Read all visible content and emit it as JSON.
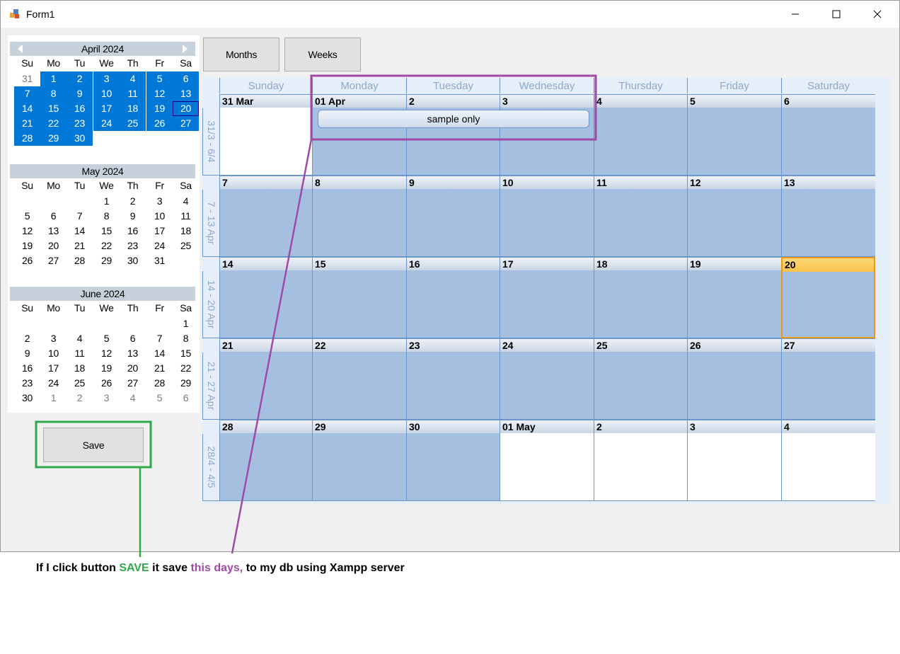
{
  "window": {
    "title": "Form1"
  },
  "accent": "#0078d7",
  "month_calendar": {
    "dow": [
      "Su",
      "Mo",
      "Tu",
      "We",
      "Th",
      "Fr",
      "Sa"
    ],
    "months": [
      {
        "title": "April 2024",
        "weeks": [
          [
            "31",
            "1",
            "2",
            "3",
            "4",
            "5",
            "6"
          ],
          [
            "7",
            "8",
            "9",
            "10",
            "11",
            "12",
            "13"
          ],
          [
            "14",
            "15",
            "16",
            "17",
            "18",
            "19",
            "20"
          ],
          [
            "21",
            "22",
            "23",
            "24",
            "25",
            "26",
            "27"
          ],
          [
            "28",
            "29",
            "30",
            "",
            "",
            "",
            ""
          ]
        ]
      },
      {
        "title": "May 2024",
        "weeks": [
          [
            "",
            "",
            "",
            "1",
            "2",
            "3",
            "4"
          ],
          [
            "5",
            "6",
            "7",
            "8",
            "9",
            "10",
            "11"
          ],
          [
            "12",
            "13",
            "14",
            "15",
            "16",
            "17",
            "18"
          ],
          [
            "19",
            "20",
            "21",
            "22",
            "23",
            "24",
            "25"
          ],
          [
            "26",
            "27",
            "28",
            "29",
            "30",
            "31",
            ""
          ]
        ]
      },
      {
        "title": "June 2024",
        "weeks": [
          [
            "",
            "",
            "",
            "",
            "",
            "",
            "1"
          ],
          [
            "2",
            "3",
            "4",
            "5",
            "6",
            "7",
            "8"
          ],
          [
            "9",
            "10",
            "11",
            "12",
            "13",
            "14",
            "15"
          ],
          [
            "16",
            "17",
            "18",
            "19",
            "20",
            "21",
            "22"
          ],
          [
            "23",
            "24",
            "25",
            "26",
            "27",
            "28",
            "29"
          ],
          [
            "30",
            "1",
            "2",
            "3",
            "4",
            "5",
            "6"
          ]
        ]
      }
    ],
    "selected_range": "1 April 2024 - 30 April 2024",
    "today": "20 April 2024"
  },
  "view_buttons": {
    "months": "Months",
    "weeks": "Weeks"
  },
  "save_button": "Save",
  "big_calendar": {
    "days": [
      "Sunday",
      "Monday",
      "Tuesday",
      "Wednesday",
      "Thursday",
      "Friday",
      "Saturday"
    ],
    "weeks": [
      {
        "label": "31/3 - 6/4",
        "dates": [
          "31 Mar",
          "01 Apr",
          "2",
          "3",
          "4",
          "5",
          "6"
        ]
      },
      {
        "label": "7 - 13 Apr",
        "dates": [
          "7",
          "8",
          "9",
          "10",
          "11",
          "12",
          "13"
        ]
      },
      {
        "label": "14 - 20 Apr",
        "dates": [
          "14",
          "15",
          "16",
          "17",
          "18",
          "19",
          "20"
        ]
      },
      {
        "label": "21 - 27 Apr",
        "dates": [
          "21",
          "22",
          "23",
          "24",
          "25",
          "26",
          "27"
        ]
      },
      {
        "label": "28/4 - 4/5",
        "dates": [
          "28",
          "29",
          "30",
          "01 May",
          "2",
          "3",
          "4"
        ]
      }
    ],
    "appointment": "sample only"
  },
  "annotation": {
    "part1": "If I click button ",
    "part2": "SAVE",
    "part3": " it save ",
    "part4": "this days,",
    "part5": " to my db using Xampp server",
    "color_save": "#2eaa4a",
    "color_days": "#a04aa8"
  }
}
